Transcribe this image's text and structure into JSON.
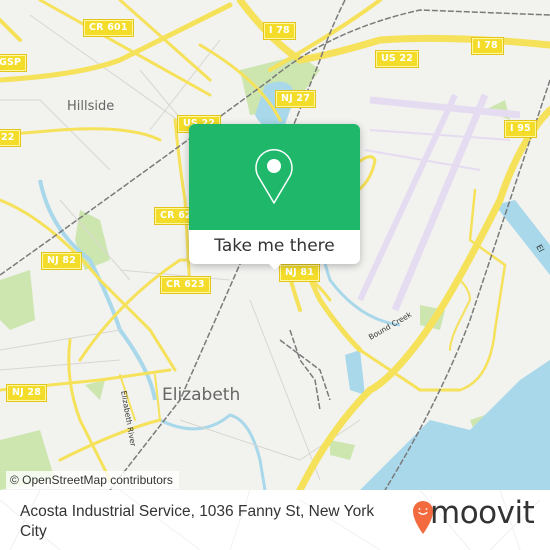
{
  "map": {
    "road_shields": [
      {
        "label": "CR 601"
      },
      {
        "label": "I 78"
      },
      {
        "label": "I 78"
      },
      {
        "label": "US 22"
      },
      {
        "label": "US 22"
      },
      {
        "label": "NJ 27"
      },
      {
        "label": "I 95"
      },
      {
        "label": "GSP"
      },
      {
        "label": "22"
      },
      {
        "label": "CR 62"
      },
      {
        "label": "NJ 82"
      },
      {
        "label": "CR 623"
      },
      {
        "label": "NJ 81"
      },
      {
        "label": "NJ 28"
      }
    ],
    "places": [
      {
        "label": "Hillside"
      },
      {
        "label": "Elizabeth"
      }
    ],
    "water_labels": [
      {
        "label": "Elizabeth River"
      },
      {
        "label": "Bound Creek"
      },
      {
        "label": "El"
      }
    ],
    "colors": {
      "land": "#f2f2ef",
      "road": "#f5e15a",
      "water": "#a8d8ea",
      "park": "#cde6b0",
      "runway": "#e6dcf2",
      "rail": "#777777"
    }
  },
  "popup": {
    "icon": "map-pin-icon",
    "button_label": "Take me there",
    "color": "#1fb86a"
  },
  "attribution": "© OpenStreetMap contributors",
  "footer": {
    "address": "Acosta Industrial Service, 1036 Fanny St, New York City",
    "logo_text": "moovit",
    "logo_color": "#f26a3d"
  }
}
